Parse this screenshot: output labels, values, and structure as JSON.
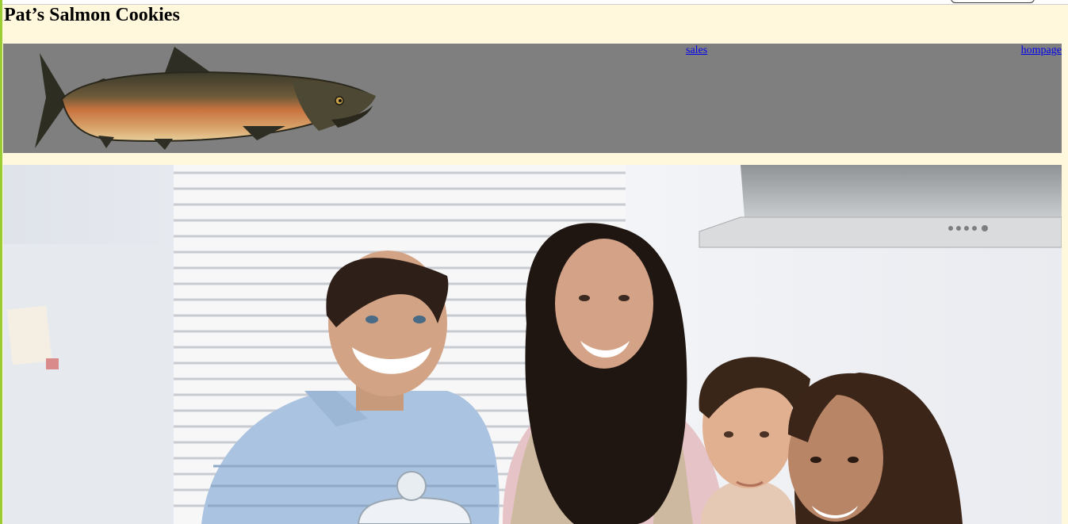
{
  "site": {
    "title": "Pat’s Salmon Cookies"
  },
  "nav": {
    "sales": "sales",
    "homepage": "hompage"
  },
  "icons": {
    "banner_image": "salmon-fish-illustration",
    "hero_image": "family-in-kitchen-photo"
  },
  "colors": {
    "page_background": "#fff8dc",
    "banner_background": "#7f7f7f",
    "link": "#0000ee",
    "left_border": "#9acd32"
  }
}
